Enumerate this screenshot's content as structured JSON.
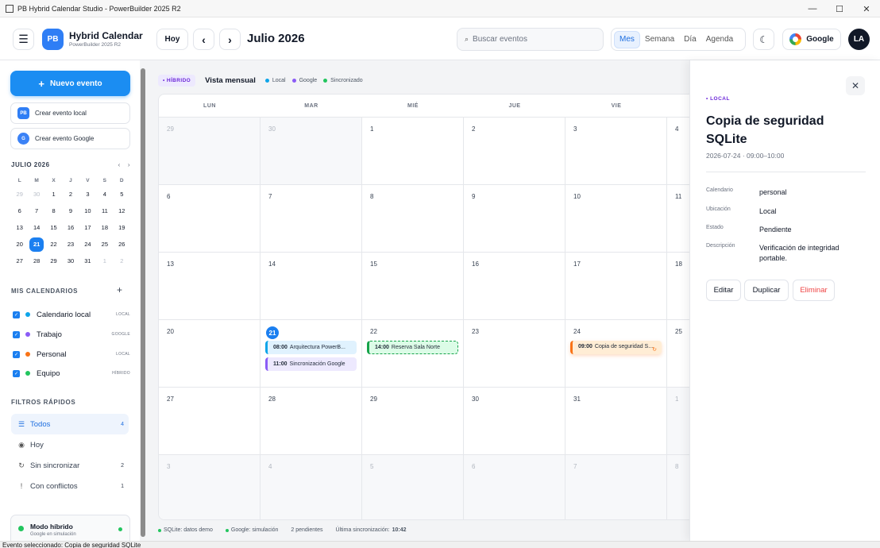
{
  "window": {
    "title": "PB Hybrid Calendar Studio - PowerBuilder 2025 R2",
    "controls": [
      "—",
      "☐",
      "✕"
    ]
  },
  "header": {
    "menu_icon": "☰",
    "logo": "PB",
    "app_name": "Hybrid Calendar",
    "app_sub": "PowerBuilder 2025 R2",
    "today_label": "Hoy",
    "prev_icon": "‹",
    "next_icon": "›",
    "month_title": "Julio 2026",
    "search_icon": "⌕",
    "search_placeholder": "Buscar eventos",
    "views": [
      "Mes",
      "Semana",
      "Día",
      "Agenda"
    ],
    "active_view": "Mes",
    "theme_icon": "☾",
    "google_label": "Google",
    "avatar": "LA"
  },
  "sidebar": {
    "new_event": {
      "icon": "+",
      "label": "Nuevo evento"
    },
    "create_local": {
      "badge": "PB",
      "label": "Crear evento local"
    },
    "create_google": {
      "badge": "G",
      "label": "Crear evento Google"
    },
    "mini_calendar": {
      "title": "JULIO 2026",
      "prev": "‹",
      "next": "›",
      "dow": [
        "L",
        "M",
        "X",
        "J",
        "V",
        "S",
        "D"
      ],
      "weeks": [
        [
          "29",
          "30",
          "1",
          "2",
          "3",
          "4",
          "5"
        ],
        [
          "6",
          "7",
          "8",
          "9",
          "10",
          "11",
          "12"
        ],
        [
          "13",
          "14",
          "15",
          "16",
          "17",
          "18",
          "19"
        ],
        [
          "20",
          "21",
          "22",
          "23",
          "24",
          "25",
          "26"
        ],
        [
          "27",
          "28",
          "29",
          "30",
          "31",
          "1",
          "2"
        ]
      ],
      "today": "21"
    },
    "calendars_title": "MIS CALENDARIOS",
    "add_calendar": "+",
    "calendars": [
      {
        "label": "Calendario local",
        "tag": "LOCAL",
        "color": "#0ea5e9"
      },
      {
        "label": "Trabajo",
        "tag": "GOOGLE",
        "color": "#8b5cf6"
      },
      {
        "label": "Personal",
        "tag": "LOCAL",
        "color": "#f97316"
      },
      {
        "label": "Equipo",
        "tag": "HÍBRIDO",
        "color": "#22c55e"
      }
    ],
    "filters_title": "FILTROS RÁPIDOS",
    "filters": [
      {
        "icon": "☰",
        "label": "Todos",
        "count": "4"
      },
      {
        "icon": "◉",
        "label": "Hoy",
        "count": ""
      },
      {
        "icon": "↻",
        "label": "Sin sincronizar",
        "count": "2"
      },
      {
        "icon": "!",
        "label": "Con conflictos",
        "count": "1"
      }
    ],
    "hybrid": {
      "title": "Modo híbrido",
      "subtitle": "Google en simulación"
    }
  },
  "main": {
    "badge": "• HÍBRIDO",
    "view_title": "Vista mensual",
    "legend": [
      {
        "label": "Local",
        "color": "#0ea5e9"
      },
      {
        "label": "Google",
        "color": "#8b5cf6"
      },
      {
        "label": "Sincronizado",
        "color": "#22c55e"
      }
    ],
    "dow": [
      "LUN",
      "MAR",
      "MIÉ",
      "JUE",
      "VIE"
    ],
    "weeks": [
      [
        "29",
        "30",
        "1",
        "2",
        "3",
        "4"
      ],
      [
        "6",
        "7",
        "8",
        "9",
        "10",
        "11"
      ],
      [
        "13",
        "14",
        "15",
        "16",
        "17",
        "18"
      ],
      [
        "20",
        "21",
        "22",
        "23",
        "24",
        "25"
      ],
      [
        "27",
        "28",
        "29",
        "30",
        "31",
        "1"
      ],
      [
        "3",
        "4",
        "5",
        "6",
        "7",
        "8"
      ]
    ],
    "events": {
      "e1": {
        "time": "08:00",
        "title": "Arquitectura PowerB...",
        "bg": "#e0f2fe",
        "border": "#0ea5e9"
      },
      "e2": {
        "time": "11:00",
        "title": "Sincronización Google",
        "bg": "#ede9fe",
        "border": "#8b5cf6"
      },
      "e3": {
        "time": "14:00",
        "title": "Reserva Sala Norte",
        "bg": "#dcfce7",
        "border": "#16a34a"
      },
      "e4": {
        "time": "09:00",
        "title": "Copia de seguridad S...",
        "bg": "#ffedd5",
        "border": "#f97316",
        "sync_icon": "↻"
      }
    },
    "status": {
      "sqlite": "SQLite: datos demo",
      "google": "Google: simulación",
      "pending": "2 pendientes",
      "last_sync_label": "Última sincronización:",
      "last_sync_time": "10:42"
    }
  },
  "panel": {
    "close": "✕",
    "source": "• LOCAL",
    "title": "Copia de seguridad SQLite",
    "when": "2026-07-24 · 09:00–10:00",
    "rows": [
      {
        "k": "Calendario",
        "v": "personal"
      },
      {
        "k": "Ubicación",
        "v": "Local"
      },
      {
        "k": "Estado",
        "v": "Pendiente"
      },
      {
        "k": "Descripción",
        "v": "Verificación de integridad portable."
      }
    ],
    "edit": "Editar",
    "duplicate": "Duplicar",
    "delete": "Eliminar"
  },
  "statusbar": "Evento seleccionado: Copia de seguridad SQLite"
}
